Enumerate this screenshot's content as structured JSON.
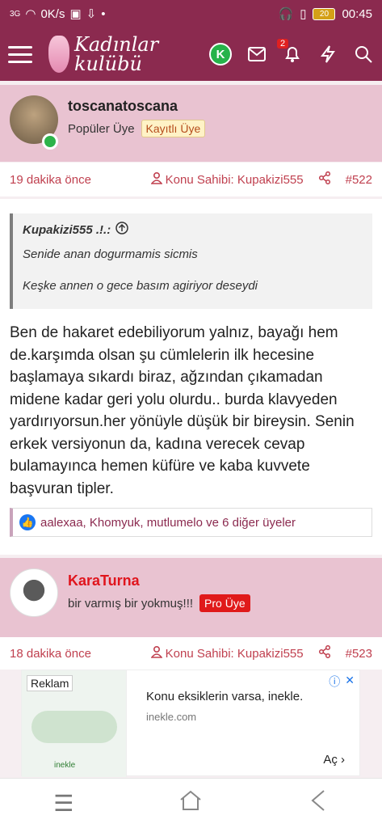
{
  "status": {
    "network": "3G",
    "speed": "0K/s",
    "battery": "20",
    "time": "00:45"
  },
  "app": {
    "logo_line1": "Kadınlar",
    "logo_line2": "kulübü",
    "user_initial": "K",
    "notif_count": "2"
  },
  "posts": [
    {
      "username": "toscanatoscana",
      "title": "Popüler Üye",
      "tag": "Kayıtlı Üye",
      "time": "19 dakika önce",
      "author": "Konu Sahibi: Kupakizi555",
      "number": "#522",
      "quote": {
        "author": "Kupakizi555 .!.:",
        "line1": "Senide anan dogurmamis sicmis",
        "line2": "Keşke annen o gece basım agiriyor deseydi"
      },
      "body": "Ben de hakaret edebiliyorum yalnız, bayağı hem de.karşımda olsan şu cümlelerin ilk hecesine başlamaya sıkardı biraz, ağzından çıkamadan midene kadar geri yolu olurdu.. burda klavyeden yardırıyorsun.her yönüyle düşük bir bireysin. Senin erkek versiyonun da, kadına verecek cevap bulamayınca hemen küfüre ve kaba kuvvete başvuran tipler.",
      "likes": "aalexaa, Khomyuk, mutlumelo ve 6 diğer üyeler"
    },
    {
      "username": "KaraTurna",
      "title": "bir varmış bir yokmuş!!!",
      "tag": "Pro Üye",
      "time": "18 dakika önce",
      "author": "Konu Sahibi: Kupakizi555",
      "number": "#523"
    }
  ],
  "ad": {
    "label": "Reklam",
    "title": "Konu eksiklerin varsa, inekle.",
    "domain": "inekle.com",
    "cta": "Aç",
    "brand": "inekle"
  }
}
